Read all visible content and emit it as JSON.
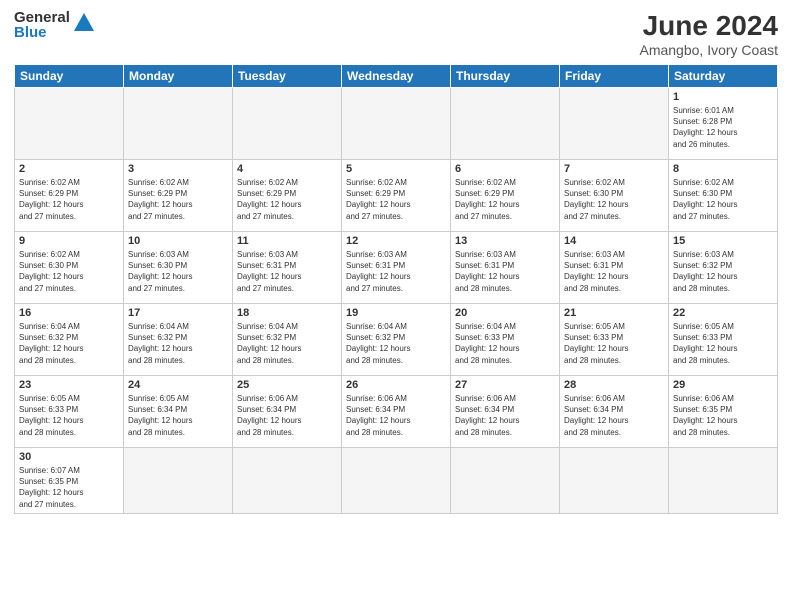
{
  "header": {
    "logo_general": "General",
    "logo_blue": "Blue",
    "month_year": "June 2024",
    "location": "Amangbo, Ivory Coast"
  },
  "days_of_week": [
    "Sunday",
    "Monday",
    "Tuesday",
    "Wednesday",
    "Thursday",
    "Friday",
    "Saturday"
  ],
  "weeks": [
    {
      "days": [
        {
          "num": "",
          "info": "",
          "empty": true
        },
        {
          "num": "",
          "info": "",
          "empty": true
        },
        {
          "num": "",
          "info": "",
          "empty": true
        },
        {
          "num": "",
          "info": "",
          "empty": true
        },
        {
          "num": "",
          "info": "",
          "empty": true
        },
        {
          "num": "",
          "info": "",
          "empty": true
        },
        {
          "num": "1",
          "info": "Sunrise: 6:01 AM\nSunset: 6:28 PM\nDaylight: 12 hours\nand 26 minutes.",
          "empty": false
        }
      ]
    },
    {
      "days": [
        {
          "num": "2",
          "info": "Sunrise: 6:02 AM\nSunset: 6:29 PM\nDaylight: 12 hours\nand 27 minutes.",
          "empty": false
        },
        {
          "num": "3",
          "info": "Sunrise: 6:02 AM\nSunset: 6:29 PM\nDaylight: 12 hours\nand 27 minutes.",
          "empty": false
        },
        {
          "num": "4",
          "info": "Sunrise: 6:02 AM\nSunset: 6:29 PM\nDaylight: 12 hours\nand 27 minutes.",
          "empty": false
        },
        {
          "num": "5",
          "info": "Sunrise: 6:02 AM\nSunset: 6:29 PM\nDaylight: 12 hours\nand 27 minutes.",
          "empty": false
        },
        {
          "num": "6",
          "info": "Sunrise: 6:02 AM\nSunset: 6:29 PM\nDaylight: 12 hours\nand 27 minutes.",
          "empty": false
        },
        {
          "num": "7",
          "info": "Sunrise: 6:02 AM\nSunset: 6:30 PM\nDaylight: 12 hours\nand 27 minutes.",
          "empty": false
        },
        {
          "num": "8",
          "info": "Sunrise: 6:02 AM\nSunset: 6:30 PM\nDaylight: 12 hours\nand 27 minutes.",
          "empty": false
        }
      ]
    },
    {
      "days": [
        {
          "num": "9",
          "info": "Sunrise: 6:02 AM\nSunset: 6:30 PM\nDaylight: 12 hours\nand 27 minutes.",
          "empty": false
        },
        {
          "num": "10",
          "info": "Sunrise: 6:03 AM\nSunset: 6:30 PM\nDaylight: 12 hours\nand 27 minutes.",
          "empty": false
        },
        {
          "num": "11",
          "info": "Sunrise: 6:03 AM\nSunset: 6:31 PM\nDaylight: 12 hours\nand 27 minutes.",
          "empty": false
        },
        {
          "num": "12",
          "info": "Sunrise: 6:03 AM\nSunset: 6:31 PM\nDaylight: 12 hours\nand 27 minutes.",
          "empty": false
        },
        {
          "num": "13",
          "info": "Sunrise: 6:03 AM\nSunset: 6:31 PM\nDaylight: 12 hours\nand 28 minutes.",
          "empty": false
        },
        {
          "num": "14",
          "info": "Sunrise: 6:03 AM\nSunset: 6:31 PM\nDaylight: 12 hours\nand 28 minutes.",
          "empty": false
        },
        {
          "num": "15",
          "info": "Sunrise: 6:03 AM\nSunset: 6:32 PM\nDaylight: 12 hours\nand 28 minutes.",
          "empty": false
        }
      ]
    },
    {
      "days": [
        {
          "num": "16",
          "info": "Sunrise: 6:04 AM\nSunset: 6:32 PM\nDaylight: 12 hours\nand 28 minutes.",
          "empty": false
        },
        {
          "num": "17",
          "info": "Sunrise: 6:04 AM\nSunset: 6:32 PM\nDaylight: 12 hours\nand 28 minutes.",
          "empty": false
        },
        {
          "num": "18",
          "info": "Sunrise: 6:04 AM\nSunset: 6:32 PM\nDaylight: 12 hours\nand 28 minutes.",
          "empty": false
        },
        {
          "num": "19",
          "info": "Sunrise: 6:04 AM\nSunset: 6:32 PM\nDaylight: 12 hours\nand 28 minutes.",
          "empty": false
        },
        {
          "num": "20",
          "info": "Sunrise: 6:04 AM\nSunset: 6:33 PM\nDaylight: 12 hours\nand 28 minutes.",
          "empty": false
        },
        {
          "num": "21",
          "info": "Sunrise: 6:05 AM\nSunset: 6:33 PM\nDaylight: 12 hours\nand 28 minutes.",
          "empty": false
        },
        {
          "num": "22",
          "info": "Sunrise: 6:05 AM\nSunset: 6:33 PM\nDaylight: 12 hours\nand 28 minutes.",
          "empty": false
        }
      ]
    },
    {
      "days": [
        {
          "num": "23",
          "info": "Sunrise: 6:05 AM\nSunset: 6:33 PM\nDaylight: 12 hours\nand 28 minutes.",
          "empty": false
        },
        {
          "num": "24",
          "info": "Sunrise: 6:05 AM\nSunset: 6:34 PM\nDaylight: 12 hours\nand 28 minutes.",
          "empty": false
        },
        {
          "num": "25",
          "info": "Sunrise: 6:06 AM\nSunset: 6:34 PM\nDaylight: 12 hours\nand 28 minutes.",
          "empty": false
        },
        {
          "num": "26",
          "info": "Sunrise: 6:06 AM\nSunset: 6:34 PM\nDaylight: 12 hours\nand 28 minutes.",
          "empty": false
        },
        {
          "num": "27",
          "info": "Sunrise: 6:06 AM\nSunset: 6:34 PM\nDaylight: 12 hours\nand 28 minutes.",
          "empty": false
        },
        {
          "num": "28",
          "info": "Sunrise: 6:06 AM\nSunset: 6:34 PM\nDaylight: 12 hours\nand 28 minutes.",
          "empty": false
        },
        {
          "num": "29",
          "info": "Sunrise: 6:06 AM\nSunset: 6:35 PM\nDaylight: 12 hours\nand 28 minutes.",
          "empty": false
        }
      ]
    },
    {
      "days": [
        {
          "num": "30",
          "info": "Sunrise: 6:07 AM\nSunset: 6:35 PM\nDaylight: 12 hours\nand 27 minutes.",
          "empty": false,
          "last": true
        },
        {
          "num": "",
          "info": "",
          "empty": true,
          "last": true
        },
        {
          "num": "",
          "info": "",
          "empty": true,
          "last": true
        },
        {
          "num": "",
          "info": "",
          "empty": true,
          "last": true
        },
        {
          "num": "",
          "info": "",
          "empty": true,
          "last": true
        },
        {
          "num": "",
          "info": "",
          "empty": true,
          "last": true
        },
        {
          "num": "",
          "info": "",
          "empty": true,
          "last": true
        }
      ]
    }
  ]
}
